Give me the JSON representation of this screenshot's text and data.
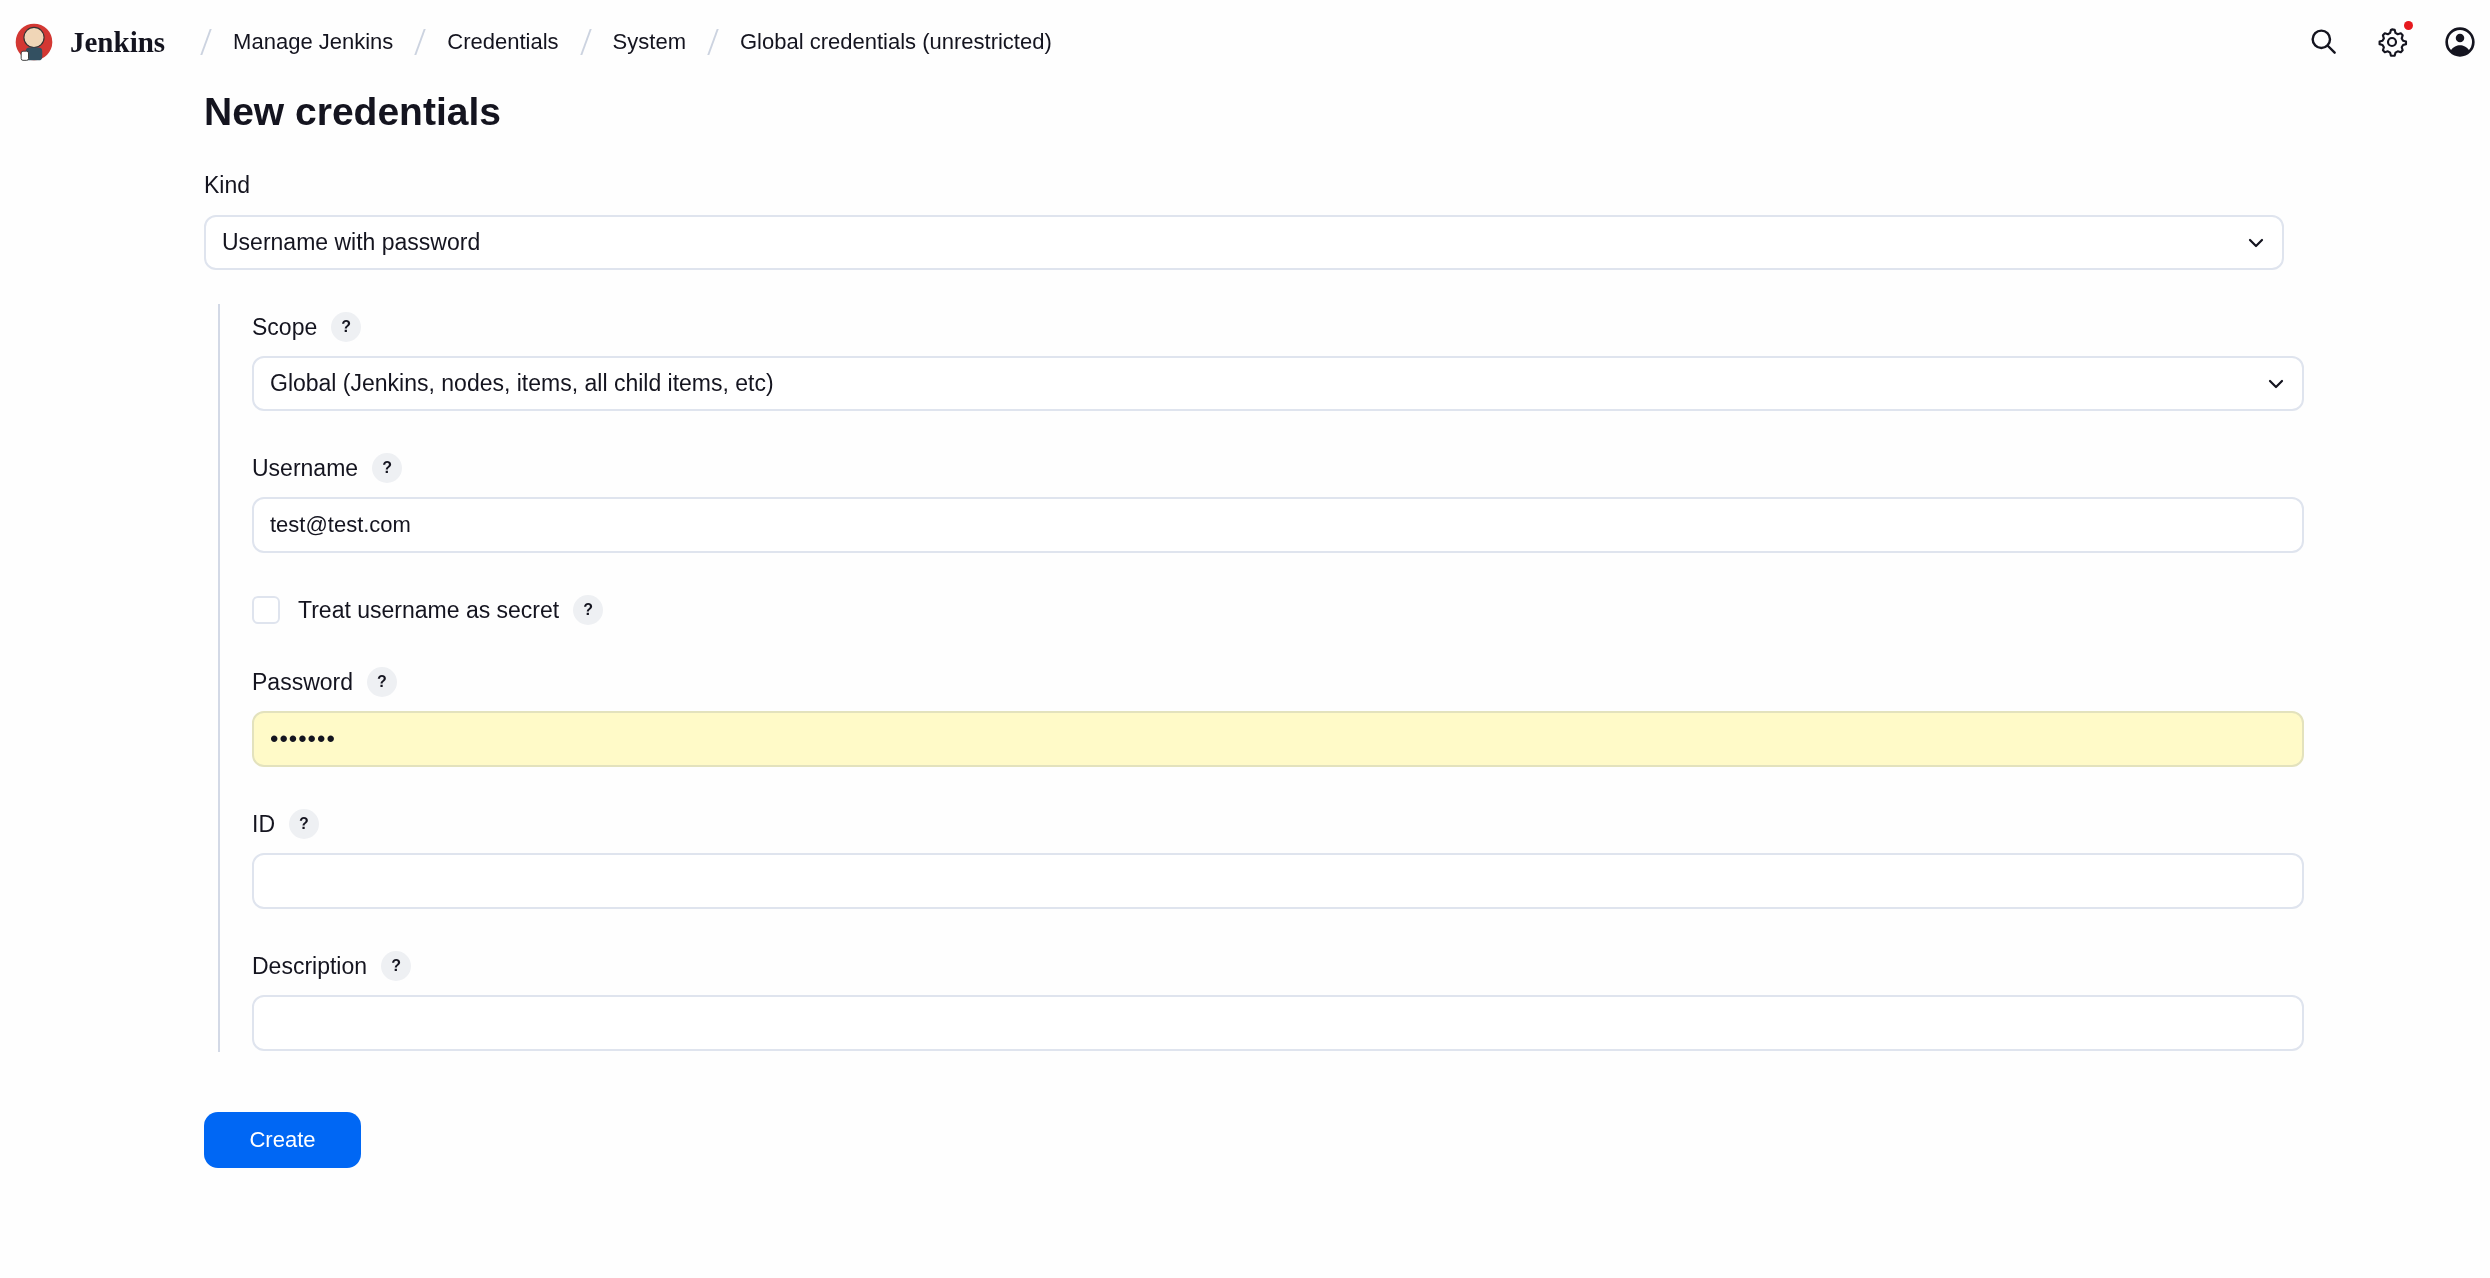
{
  "header": {
    "logo_text": "Jenkins",
    "breadcrumbs": [
      "Manage Jenkins",
      "Credentials",
      "System",
      "Global credentials (unrestricted)"
    ],
    "settings_notification": true
  },
  "page": {
    "title": "New credentials"
  },
  "kind": {
    "label": "Kind",
    "value": "Username with password"
  },
  "fields": [
    {
      "kind": "select",
      "label": "Scope",
      "help": "?",
      "value": "Global (Jenkins, nodes, items, all child items, etc)"
    },
    {
      "kind": "text",
      "label": "Username",
      "help": "?",
      "value": "test@test.com"
    },
    {
      "kind": "checkbox",
      "label": "Treat username as secret",
      "help": "?",
      "checked": false
    },
    {
      "kind": "text",
      "label": "Password",
      "help": "?",
      "value": "•••••••",
      "autofilled": true
    },
    {
      "kind": "text",
      "label": "ID",
      "help": "?"
    },
    {
      "kind": "text",
      "label": "Description",
      "help": "?"
    }
  ],
  "create_button": "Create"
}
